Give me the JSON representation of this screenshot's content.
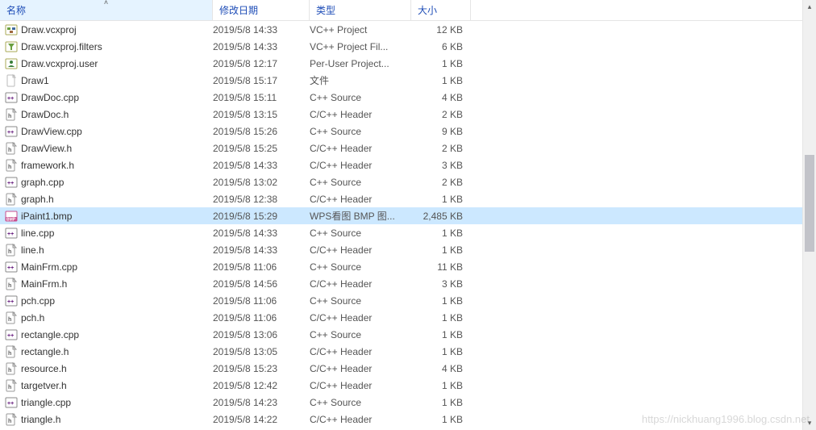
{
  "header": {
    "name": "名称",
    "date": "修改日期",
    "type": "类型",
    "size": "大小"
  },
  "watermark": "https://nickhuang1996.blog.csdn.net",
  "files": [
    {
      "icon": "proj",
      "name": "Draw.vcxproj",
      "date": "2019/5/8 14:33",
      "type": "VC++ Project",
      "size": "12 KB",
      "selected": false
    },
    {
      "icon": "proj-filter",
      "name": "Draw.vcxproj.filters",
      "date": "2019/5/8 14:33",
      "type": "VC++ Project Fil...",
      "size": "6 KB",
      "selected": false
    },
    {
      "icon": "proj-user",
      "name": "Draw.vcxproj.user",
      "date": "2019/5/8 12:17",
      "type": "Per-User Project...",
      "size": "1 KB",
      "selected": false
    },
    {
      "icon": "file",
      "name": "Draw1",
      "date": "2019/5/8 15:17",
      "type": "文件",
      "size": "1 KB",
      "selected": false
    },
    {
      "icon": "cpp",
      "name": "DrawDoc.cpp",
      "date": "2019/5/8 15:11",
      "type": "C++ Source",
      "size": "4 KB",
      "selected": false
    },
    {
      "icon": "h",
      "name": "DrawDoc.h",
      "date": "2019/5/8 13:15",
      "type": "C/C++ Header",
      "size": "2 KB",
      "selected": false
    },
    {
      "icon": "cpp",
      "name": "DrawView.cpp",
      "date": "2019/5/8 15:26",
      "type": "C++ Source",
      "size": "9 KB",
      "selected": false
    },
    {
      "icon": "h",
      "name": "DrawView.h",
      "date": "2019/5/8 15:25",
      "type": "C/C++ Header",
      "size": "2 KB",
      "selected": false
    },
    {
      "icon": "h",
      "name": "framework.h",
      "date": "2019/5/8 14:33",
      "type": "C/C++ Header",
      "size": "3 KB",
      "selected": false
    },
    {
      "icon": "cpp",
      "name": "graph.cpp",
      "date": "2019/5/8 13:02",
      "type": "C++ Source",
      "size": "2 KB",
      "selected": false
    },
    {
      "icon": "h",
      "name": "graph.h",
      "date": "2019/5/8 12:38",
      "type": "C/C++ Header",
      "size": "1 KB",
      "selected": false
    },
    {
      "icon": "bmp",
      "name": "iPaint1.bmp",
      "date": "2019/5/8 15:29",
      "type": "WPS看图 BMP 图...",
      "size": "2,485 KB",
      "selected": true
    },
    {
      "icon": "cpp",
      "name": "line.cpp",
      "date": "2019/5/8 14:33",
      "type": "C++ Source",
      "size": "1 KB",
      "selected": false
    },
    {
      "icon": "h",
      "name": "line.h",
      "date": "2019/5/8 14:33",
      "type": "C/C++ Header",
      "size": "1 KB",
      "selected": false
    },
    {
      "icon": "cpp",
      "name": "MainFrm.cpp",
      "date": "2019/5/8 11:06",
      "type": "C++ Source",
      "size": "11 KB",
      "selected": false
    },
    {
      "icon": "h",
      "name": "MainFrm.h",
      "date": "2019/5/8 14:56",
      "type": "C/C++ Header",
      "size": "3 KB",
      "selected": false
    },
    {
      "icon": "cpp",
      "name": "pch.cpp",
      "date": "2019/5/8 11:06",
      "type": "C++ Source",
      "size": "1 KB",
      "selected": false
    },
    {
      "icon": "h",
      "name": "pch.h",
      "date": "2019/5/8 11:06",
      "type": "C/C++ Header",
      "size": "1 KB",
      "selected": false
    },
    {
      "icon": "cpp",
      "name": "rectangle.cpp",
      "date": "2019/5/8 13:06",
      "type": "C++ Source",
      "size": "1 KB",
      "selected": false
    },
    {
      "icon": "h",
      "name": "rectangle.h",
      "date": "2019/5/8 13:05",
      "type": "C/C++ Header",
      "size": "1 KB",
      "selected": false
    },
    {
      "icon": "h",
      "name": "resource.h",
      "date": "2019/5/8 15:23",
      "type": "C/C++ Header",
      "size": "4 KB",
      "selected": false
    },
    {
      "icon": "h",
      "name": "targetver.h",
      "date": "2019/5/8 12:42",
      "type": "C/C++ Header",
      "size": "1 KB",
      "selected": false
    },
    {
      "icon": "cpp",
      "name": "triangle.cpp",
      "date": "2019/5/8 14:23",
      "type": "C++ Source",
      "size": "1 KB",
      "selected": false
    },
    {
      "icon": "h",
      "name": "triangle.h",
      "date": "2019/5/8 14:22",
      "type": "C/C++ Header",
      "size": "1 KB",
      "selected": false
    }
  ]
}
